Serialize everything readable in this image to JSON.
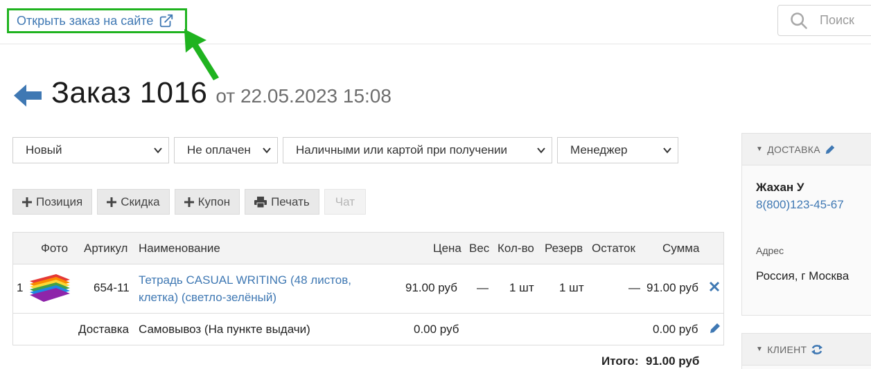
{
  "top": {
    "open_link": "Открыть заказ на сайте",
    "search_placeholder": "Поиск"
  },
  "order": {
    "title": "Заказ 1016",
    "date": "от 22.05.2023 15:08"
  },
  "selects": {
    "status": "Новый",
    "payment": "Не оплачен",
    "payment_method": "Наличными или картой при получении",
    "manager": "Менеджер"
  },
  "actions": {
    "position": "Позиция",
    "discount": "Скидка",
    "coupon": "Купон",
    "print": "Печать",
    "chat": "Чат"
  },
  "table": {
    "headers": {
      "photo": "Фото",
      "sku": "Артикул",
      "name": "Наименование",
      "price": "Цена",
      "weight": "Вес",
      "qty": "Кол-во",
      "reserve": "Резерв",
      "stock": "Остаток",
      "sum": "Сумма"
    },
    "rows": [
      {
        "index": "1",
        "sku": "654-11",
        "name_line1": "Тетрадь CASUAL WRITING (48 листов,",
        "name_line2": "клетка) (светло-зелёный)",
        "price": "91.00 руб",
        "weight": "—",
        "qty": "1 шт",
        "reserve": "1 шт",
        "stock": "—",
        "sum": "91.00 руб"
      }
    ],
    "delivery": {
      "label": "Доставка",
      "name": "Самовывоз (На пункте выдачи)",
      "price": "0.00 руб",
      "sum": "0.00 руб"
    },
    "total_label": "Итого:",
    "total_value": "91.00 руб"
  },
  "delivery_panel": {
    "title": "ДОСТАВКА",
    "name": "Жахан У",
    "phone": "8(800)123-45-67",
    "address_label": "Адрес",
    "address": "Россия, г Москва"
  },
  "client_panel": {
    "title": "КЛИЕНТ"
  },
  "colors": {
    "link": "#3f78b3",
    "highlight": "#1fb31f",
    "back_arrow": "#3f78b3"
  },
  "icons": [
    "external-link-icon",
    "search-icon",
    "back-arrow-icon",
    "chevron-down-icon",
    "plus-icon",
    "printer-icon",
    "close-icon",
    "pencil-icon",
    "refresh-icon"
  ]
}
